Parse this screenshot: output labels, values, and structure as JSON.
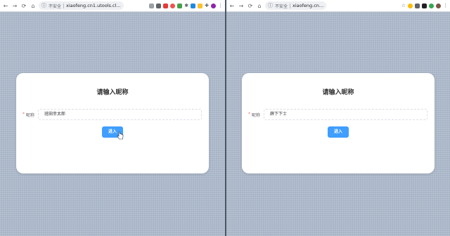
{
  "left_window": {
    "nav": {
      "back": "←",
      "forward": "→",
      "reload": "⟳",
      "home": "⌂"
    },
    "address": {
      "security_label": "不安全",
      "url": "xiaofeng.cn1.utools.cl..."
    },
    "card": {
      "title": "请输入昵称",
      "nickname_label": "昵称",
      "required_mark": "*",
      "nickname_value": "班田幸太郎",
      "enter_button": "进入"
    }
  },
  "right_window": {
    "nav": {
      "back": "←",
      "forward": "→",
      "reload": "⟳",
      "home": "⌂"
    },
    "address": {
      "security_label": "不安全",
      "url": "xiaofeng.cn..."
    },
    "card": {
      "title": "请输入昵称",
      "nickname_label": "昵称",
      "required_mark": "*",
      "nickname_value": "薛下下士",
      "enter_button": "进入"
    }
  },
  "colors": {
    "primary": "#409eff",
    "page_bg": "#a7b4c6",
    "required": "#f56c6c"
  },
  "extension_icons": {
    "left": [
      "bookmark-icon",
      "translate-icon",
      "photo-icon",
      "vue-icon",
      "star-icon",
      "gear-icon",
      "folder-icon",
      "puzzle-icon",
      "profile-icon",
      "more-icon"
    ],
    "right": [
      "star-icon",
      "chrome-icon",
      "grid-icon",
      "cloud-icon",
      "puzzle-icon",
      "profile-icon",
      "more-icon"
    ]
  }
}
